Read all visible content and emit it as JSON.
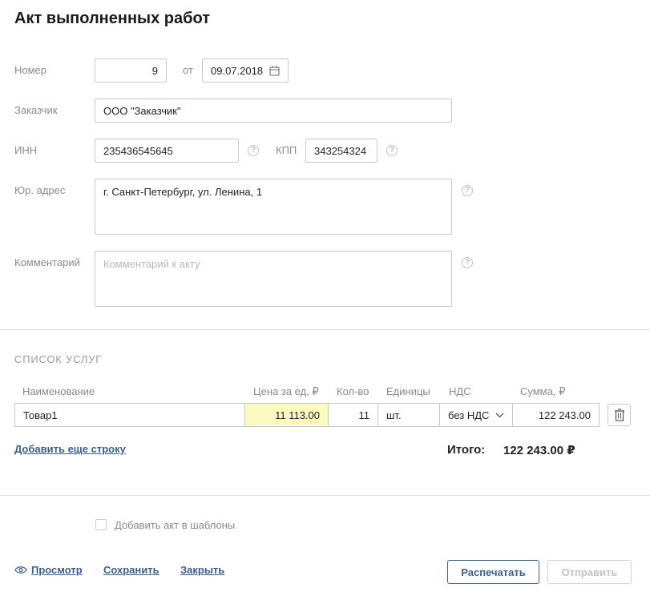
{
  "page": {
    "title": "Акт выполненных работ"
  },
  "form": {
    "number_label": "Номер",
    "number_value": "9",
    "date_prefix": "от",
    "date_value": "09.07.2018",
    "customer_label": "Заказчик",
    "customer_value": "ООО \"Заказчик\"",
    "inn_label": "ИНН",
    "inn_value": "235436545645",
    "kpp_label": "КПП",
    "kpp_value": "343254324",
    "address_label": "Юр. адрес",
    "address_value": "г. Санкт-Петербург, ул. Ленина, 1",
    "comment_label": "Комментарий",
    "comment_placeholder": "Комментарий к акту",
    "help_glyph": "?"
  },
  "services": {
    "section_title": "Список услуг",
    "columns": {
      "name": "Наименование",
      "price": "Цена за ед, ₽",
      "qty": "Кол-во",
      "unit": "Единицы",
      "vat": "НДС",
      "sum": "Сумма, ₽"
    },
    "rows": [
      {
        "name": "Товар1",
        "price": "11 113.00",
        "qty": "11",
        "unit": "шт.",
        "vat": "без НДС",
        "sum": "122 243.00"
      }
    ],
    "add_row_label": "Добавить еще строку",
    "total_label": "Итого:",
    "total_value": "122 243.00 ₽"
  },
  "template_checkbox": {
    "label": "Добавить акт в шаблоны",
    "checked": false
  },
  "footer": {
    "preview_label": "Просмотр",
    "save_label": "Сохранить",
    "close_label": "Закрыть",
    "print_label": "Распечатать",
    "send_label": "Отправить"
  },
  "colors": {
    "link": "#3d5d88",
    "highlight": "#fbfbc1"
  },
  "icons": [
    "calendar-icon",
    "help-icon",
    "chevron-down-icon",
    "trash-icon",
    "eye-icon"
  ]
}
